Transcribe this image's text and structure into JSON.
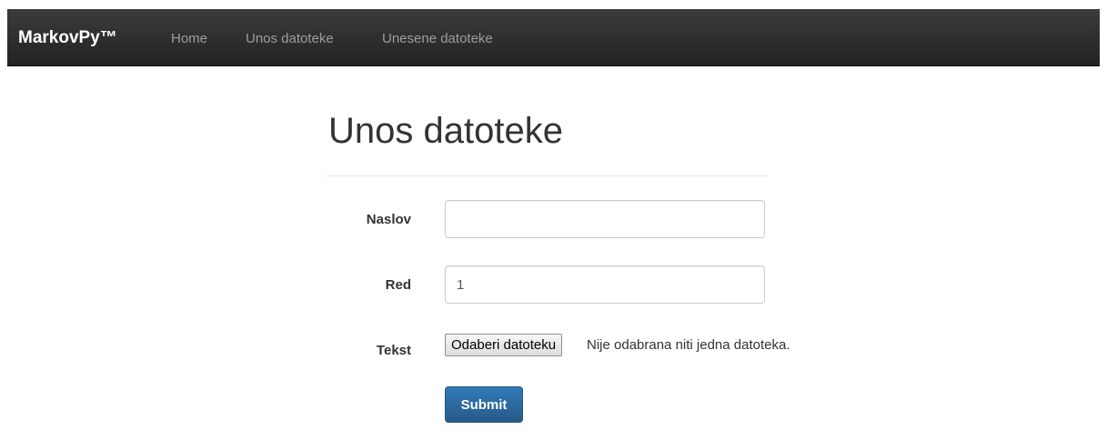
{
  "navbar": {
    "brand": "MarkovPy™",
    "links": [
      {
        "label": "Home"
      },
      {
        "label": "Unos datoteke"
      },
      {
        "label": "Unesene datoteke"
      }
    ],
    "background": "#222222",
    "link_color": "#9d9d9d"
  },
  "main": {
    "title": "Unos datoteke"
  },
  "form": {
    "naslov": {
      "label": "Naslov",
      "value": ""
    },
    "red": {
      "label": "Red",
      "value": "1"
    },
    "tekst": {
      "label": "Tekst",
      "button_label": "Odaberi datoteku",
      "status": "Nije odabrana niti jedna datoteka."
    },
    "submit_label": "Submit",
    "submit_color": "#337ab7"
  }
}
